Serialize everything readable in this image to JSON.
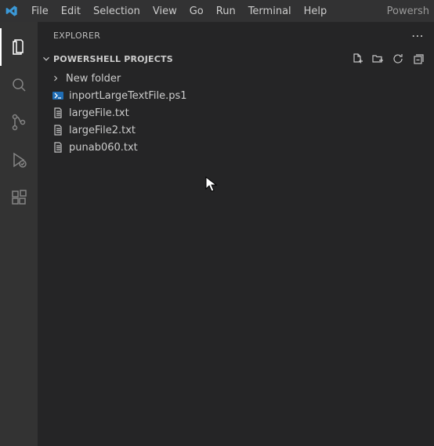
{
  "menu": [
    "File",
    "Edit",
    "Selection",
    "View",
    "Go",
    "Run",
    "Terminal",
    "Help"
  ],
  "titleRight": "Powersh",
  "explorer": {
    "title": "EXPLORER",
    "section": "POWERSHELL PROJECTS",
    "tree": [
      {
        "type": "folder",
        "label": "New folder"
      },
      {
        "type": "ps1",
        "label": "inportLargeTextFile.ps1"
      },
      {
        "type": "txt",
        "label": "largeFile.txt"
      },
      {
        "type": "txt",
        "label": "largeFile2.txt"
      },
      {
        "type": "txt",
        "label": "punab060.txt"
      }
    ]
  }
}
